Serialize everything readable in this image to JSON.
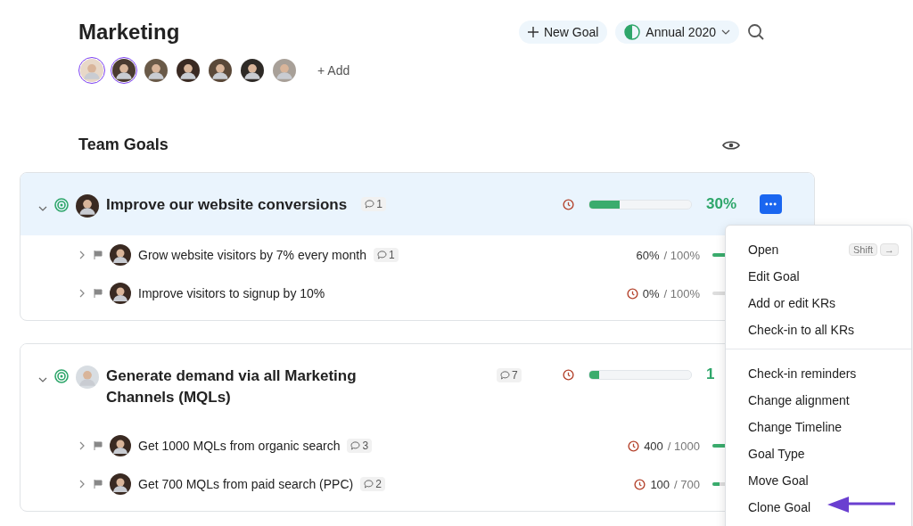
{
  "header": {
    "title": "Marketing",
    "new_goal": "New Goal",
    "period": "Annual 2020",
    "add_member": "+ Add"
  },
  "members": [
    {
      "selected": true
    },
    {
      "selected": true
    },
    {
      "selected": false
    },
    {
      "selected": false
    },
    {
      "selected": false
    },
    {
      "selected": false
    },
    {
      "selected": false
    }
  ],
  "section": {
    "title": "Team Goals"
  },
  "goals": [
    {
      "title": "Improve our website conversions",
      "comments": "1",
      "selected": true,
      "expanded": true,
      "level": 0.3,
      "percent": "30%",
      "overdue": true,
      "key_results": [
        {
          "title": "Grow website visitors by 7% every month",
          "comments": "1",
          "overdue": false,
          "current": "60%",
          "target": "/ 100%",
          "level": 0.6
        },
        {
          "title": "Improve visitors to signup by 10%",
          "overdue": true,
          "current": "0%",
          "target": "/ 100%",
          "level": 0
        }
      ]
    },
    {
      "title": "Generate demand via all Marketing Channels (MQLs)",
      "comments": "7",
      "selected": false,
      "expanded": true,
      "level": 0.1,
      "percent": "1",
      "overdue": true,
      "key_results": [
        {
          "title": "Get 1000 MQLs from organic search",
          "comments": "3",
          "overdue": true,
          "current": "400",
          "target": "/ 1000",
          "level": 0.4
        },
        {
          "title": "Get 700 MQLs from paid search (PPC)",
          "comments": "2",
          "overdue": true,
          "current": "100",
          "target": "/ 700",
          "level": 0.14
        }
      ]
    }
  ],
  "menu": {
    "groups": [
      [
        {
          "label": "Open",
          "shortcut": [
            "Shift",
            "→"
          ]
        },
        {
          "label": "Edit Goal"
        },
        {
          "label": "Add or edit KRs"
        },
        {
          "label": "Check-in to all KRs"
        }
      ],
      [
        {
          "label": "Check-in reminders"
        },
        {
          "label": "Change alignment"
        },
        {
          "label": "Change Timeline"
        },
        {
          "label": "Goal Type"
        },
        {
          "label": "Move Goal"
        },
        {
          "label": "Clone Goal",
          "pointed": true
        }
      ]
    ]
  }
}
